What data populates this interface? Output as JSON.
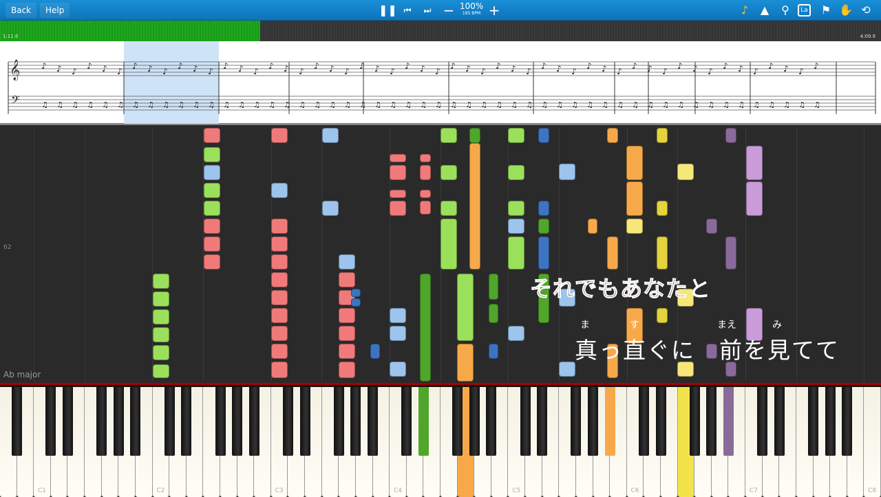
{
  "toolbar": {
    "back": "Back",
    "help": "Help",
    "tempo_percent": "100%",
    "bpm": "195 BPM",
    "icons": [
      "pause-icon",
      "skip-back-icon",
      "skip-forward-icon",
      "minus-icon",
      "plus-icon",
      "music-note-icon",
      "metronome-icon",
      "zoom-icon",
      "la-label-icon",
      "location-pin-icon",
      "hand-icon",
      "loop-icon"
    ],
    "la_label": "La"
  },
  "progress": {
    "elapsed": "1:11.6",
    "total": "4:09.9",
    "fraction": 0.295
  },
  "waterfall": {
    "measure_number": "62",
    "key_signature": "Ab major"
  },
  "lyrics": {
    "line1_sung": "それでもあなた",
    "line1_rest": "と",
    "line2": "真っ直ぐに　前を見てて",
    "furigana": [
      {
        "text": "ま"
      },
      {
        "text": "す"
      },
      {
        "text": "まえ"
      },
      {
        "text": "み"
      }
    ]
  },
  "keyboard": {
    "labels": [
      "C1",
      "C2",
      "C3",
      "C4",
      "C5",
      "C6",
      "C7",
      "C8"
    ]
  },
  "colors": {
    "toolbar": "#1186cf",
    "progress": "#1fa81f",
    "green": "#9be05a",
    "red": "#f07a7a",
    "blue": "#9cc4ec",
    "orange": "#f7a94a",
    "yellow": "#f3e34a",
    "purple": "#c99bd9"
  }
}
